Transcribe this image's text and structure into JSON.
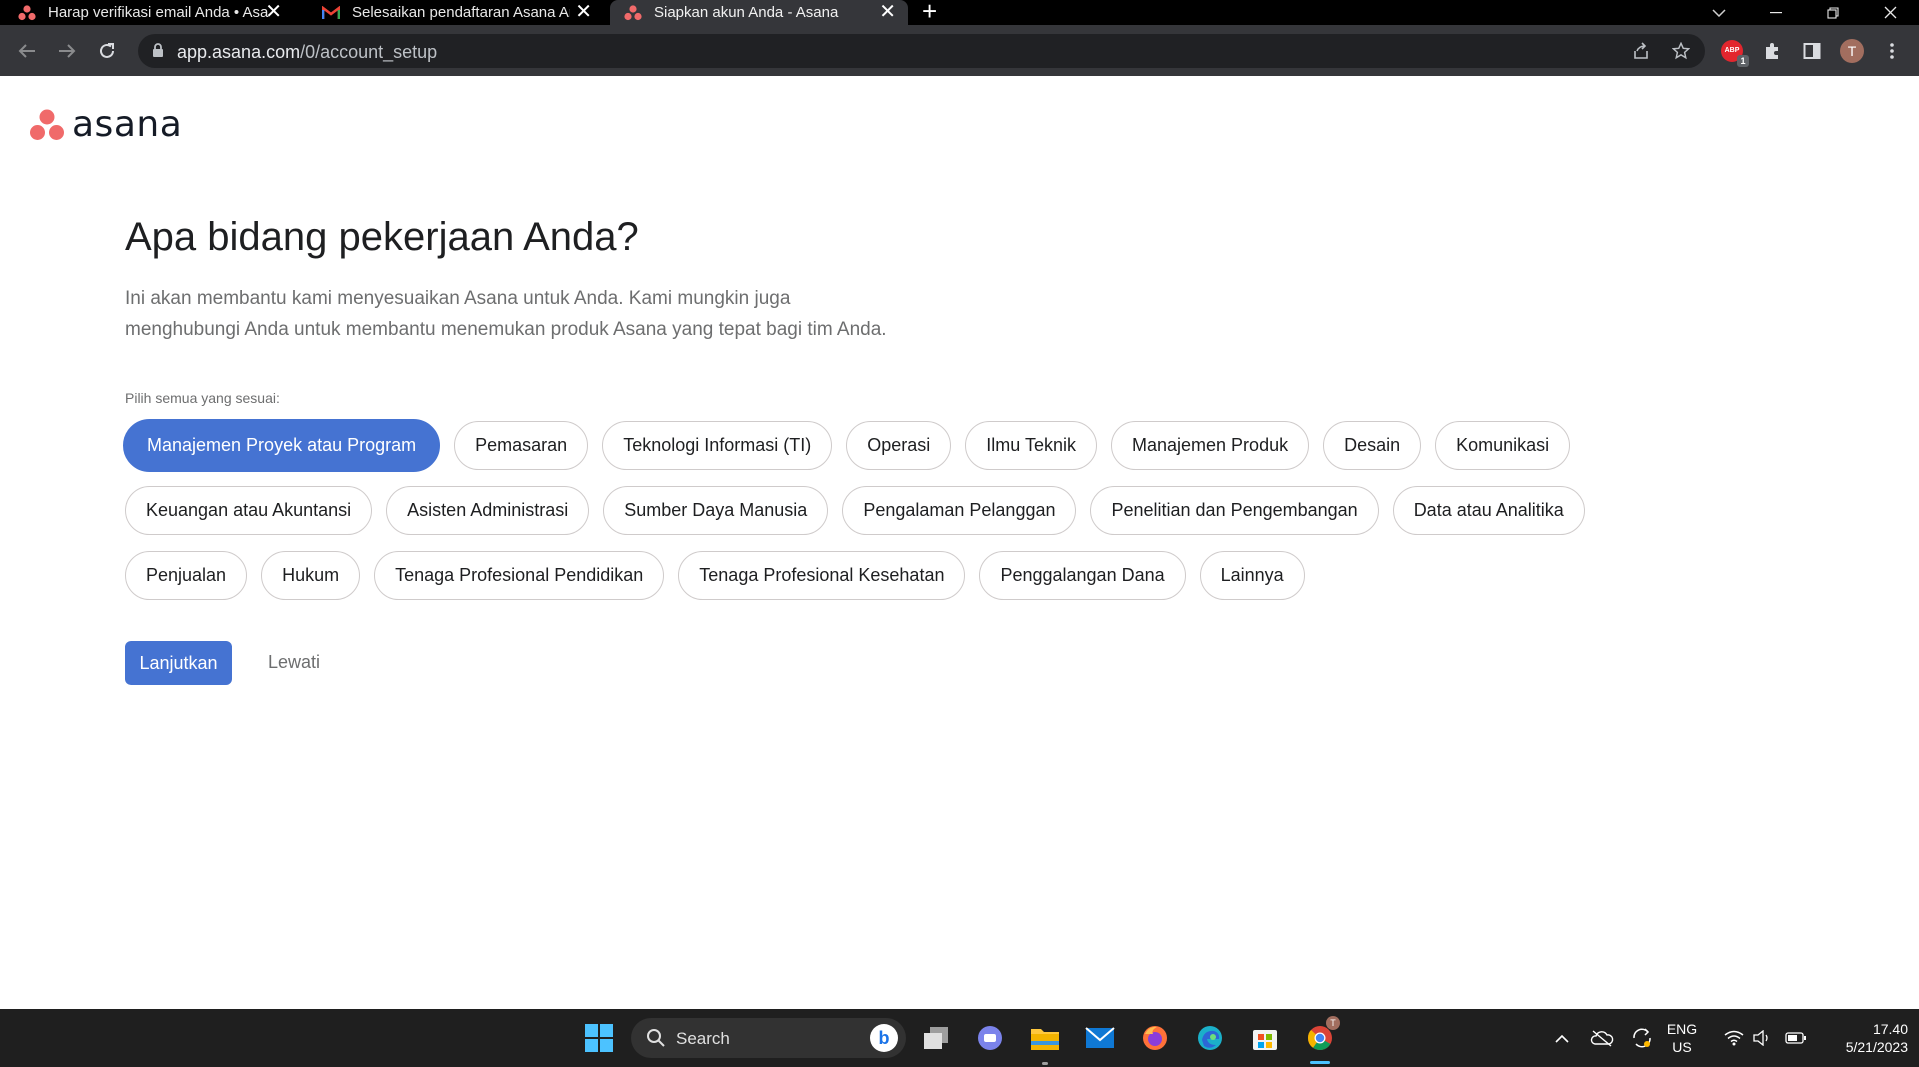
{
  "browser": {
    "tabs": [
      {
        "title": "Harap verifikasi email Anda • Asa",
        "favicon": "asana-icon",
        "active": false
      },
      {
        "title": "Selesaikan pendaftaran Asana An",
        "favicon": "gmail-icon",
        "active": false
      },
      {
        "title": "Siapkan akun Anda - Asana",
        "favicon": "asana-icon",
        "active": true
      }
    ],
    "url_host": "app.asana.com",
    "url_path": "/0/account_setup",
    "profile_initial": "T",
    "extension_badge": "1",
    "extension_label": "ABP"
  },
  "page": {
    "logo_text": "asana",
    "heading": "Apa bidang pekerjaan Anda?",
    "subtext_line1": "Ini akan membantu kami menyesuaikan Asana untuk Anda. Kami mungkin juga",
    "subtext_line2": "menghubungi Anda untuk membantu menemukan produk Asana yang tepat bagi tim Anda.",
    "pick_label": "Pilih semua yang sesuai:",
    "options": [
      {
        "label": "Manajemen Proyek atau Program",
        "selected": true
      },
      {
        "label": "Pemasaran",
        "selected": false
      },
      {
        "label": "Teknologi Informasi (TI)",
        "selected": false
      },
      {
        "label": "Operasi",
        "selected": false
      },
      {
        "label": "Ilmu Teknik",
        "selected": false
      },
      {
        "label": "Manajemen Produk",
        "selected": false
      },
      {
        "label": "Desain",
        "selected": false
      },
      {
        "label": "Komunikasi",
        "selected": false
      },
      {
        "label": "Keuangan atau Akuntansi",
        "selected": false
      },
      {
        "label": "Asisten Administrasi",
        "selected": false
      },
      {
        "label": "Sumber Daya Manusia",
        "selected": false
      },
      {
        "label": "Pengalaman Pelanggan",
        "selected": false
      },
      {
        "label": "Penelitian dan Pengembangan",
        "selected": false
      },
      {
        "label": "Data atau Analitika",
        "selected": false
      },
      {
        "label": "Penjualan",
        "selected": false
      },
      {
        "label": "Hukum",
        "selected": false
      },
      {
        "label": "Tenaga Profesional Pendidikan",
        "selected": false
      },
      {
        "label": "Tenaga Profesional Kesehatan",
        "selected": false
      },
      {
        "label": "Penggalangan Dana",
        "selected": false
      },
      {
        "label": "Lainnya",
        "selected": false
      }
    ],
    "continue_label": "Lanjutkan",
    "skip_label": "Lewati"
  },
  "taskbar": {
    "search_label": "Search",
    "language_line1": "ENG",
    "language_line2": "US",
    "time": "17.40",
    "date": "5/21/2023"
  },
  "colors": {
    "accent": "#4573d2",
    "asana_logo": "#f06a6a",
    "chip_border": "#cfcbcb"
  }
}
